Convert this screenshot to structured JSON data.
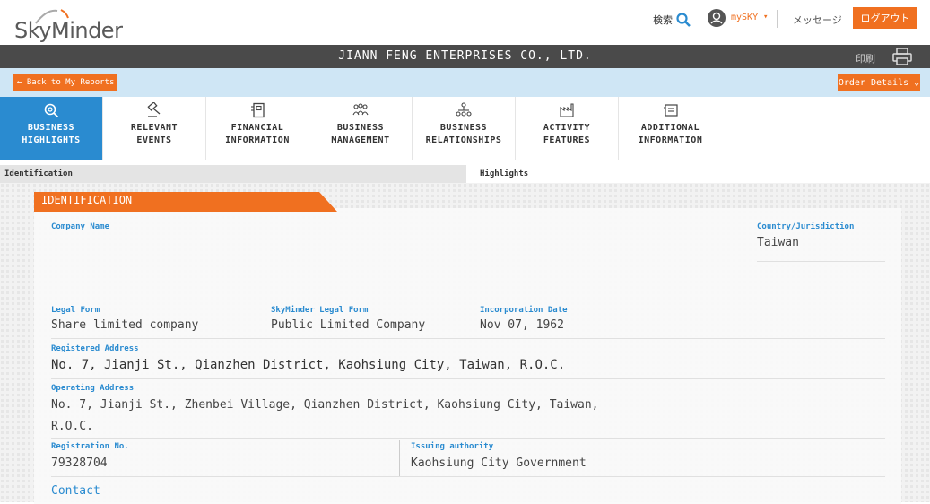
{
  "header": {
    "logo_text": "SkyMinder",
    "search_label": "検索",
    "user_label": "mySKY",
    "messages_label": "メッセージ",
    "logout_label": "ログアウト"
  },
  "titlebar": {
    "company_name": "JIANN FENG ENTERPRISES CO., LTD.",
    "print_label": "印刷"
  },
  "actionbar": {
    "back_label": "← Back to My Reports",
    "order_details_label": "Order Details ⌄"
  },
  "tabs": [
    {
      "line1": "BUSINESS",
      "line2": "HIGHLIGHTS",
      "icon": "search-icon",
      "active": true
    },
    {
      "line1": "RELEVANT",
      "line2": "EVENTS",
      "icon": "gavel-icon",
      "active": false
    },
    {
      "line1": "FINANCIAL",
      "line2": "INFORMATION",
      "icon": "financial-doc-icon",
      "active": false
    },
    {
      "line1": "BUSINESS",
      "line2": "MANAGEMENT",
      "icon": "people-icon",
      "active": false
    },
    {
      "line1": "BUSINESS",
      "line2": "RELATIONSHIPS",
      "icon": "org-chart-icon",
      "active": false
    },
    {
      "line1": "ACTIVITY",
      "line2": "FEATURES",
      "icon": "factory-icon",
      "active": false
    },
    {
      "line1": "ADDITIONAL",
      "line2": "INFORMATION",
      "icon": "info-doc-icon",
      "active": false
    }
  ],
  "subtabs": {
    "identification": "Identification",
    "highlights": "Highlights"
  },
  "identification": {
    "section_title": "IDENTIFICATION",
    "company_name_label": "Company Name",
    "country_label": "Country/Jurisdiction",
    "country_value": "Taiwan",
    "legal_form_label": "Legal Form",
    "legal_form_value": "Share limited company",
    "skyminder_legal_form_label": "SkyMinder Legal Form",
    "skyminder_legal_form_value": "Public Limited Company",
    "incorporation_label": "Incorporation Date",
    "incorporation_value": "Nov 07, 1962",
    "registered_address_label": "Registered Address",
    "registered_address_value": "No. 7, Jianji St., Qianzhen District, Kaohsiung City, Taiwan, R.O.C.",
    "operating_address_label": "Operating Address",
    "operating_address_line1": "No. 7, Jianji St., Zhenbei Village, Qianzhen District, Kaohsiung City, Taiwan,",
    "operating_address_line2": "R.O.C.",
    "registration_label": "Registration No.",
    "registration_value": "79328704",
    "issuing_label": "Issuing authority",
    "issuing_value": "Kaohsiung City Government",
    "contact_label": "Contact"
  },
  "colors": {
    "accent_orange": "#f07020",
    "accent_blue": "#2a8bd0",
    "titlebar": "#4a4a4a"
  }
}
